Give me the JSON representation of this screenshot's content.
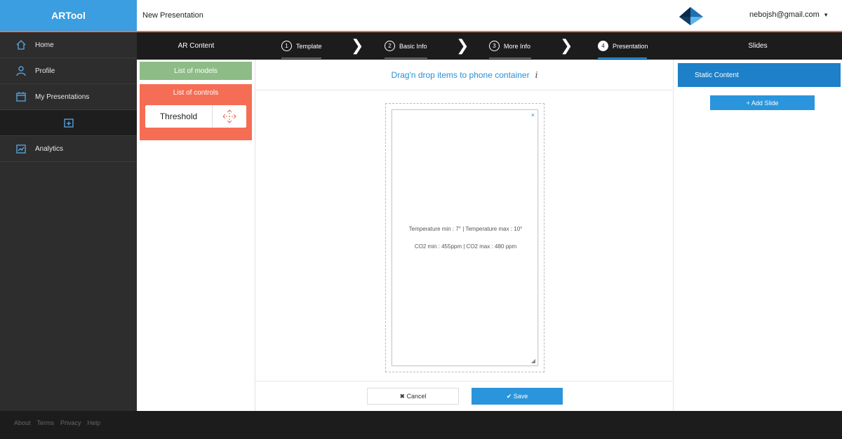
{
  "app": {
    "logo": "ARTool",
    "document_title": "New Presentation"
  },
  "user": {
    "email": "nebojsh@gmail.com",
    "caret": "▾"
  },
  "sidebar": {
    "items": [
      {
        "label": "Home",
        "icon": "home-icon"
      },
      {
        "label": "Profile",
        "icon": "user-icon"
      },
      {
        "label": "My Presentations",
        "icon": "calendar-icon"
      },
      {
        "label": "",
        "icon": "add-presentation-icon"
      },
      {
        "label": "Analytics",
        "icon": "analytics-icon"
      }
    ]
  },
  "columns": {
    "ar_content": "AR Content",
    "slides": "Slides"
  },
  "steps": [
    {
      "num": "1",
      "label": "Template"
    },
    {
      "num": "2",
      "label": "Basic Info"
    },
    {
      "num": "3",
      "label": "More Info"
    },
    {
      "num": "4",
      "label": "Presentation"
    }
  ],
  "ar_panel": {
    "models_button": "List of models",
    "controls_title": "List of controls",
    "control_item": "Threshold"
  },
  "editor": {
    "instructions": "Drag'n drop items to phone container",
    "info_icon": "i",
    "close": "×",
    "resize": "◢",
    "line1": "Temperature min : 7° | Temperature max : 10°",
    "line2": "CO2 min : 455ppm | CO2 max : 480 ppm",
    "cancel_label": "✖ Cancel",
    "save_label": "✔ Save"
  },
  "slides_panel": {
    "static_content": "Static Content",
    "add_slide": "+ Add Slide"
  },
  "footer": {
    "links": [
      "About",
      "Terms",
      "Privacy",
      "Help"
    ]
  },
  "colors": {
    "logo_blue": "#3a9ee0",
    "accent_blue": "#2a95dc",
    "models_green": "#8dbc86",
    "controls_red": "#f56d54",
    "sidebar_dark": "#2d2d2d"
  }
}
